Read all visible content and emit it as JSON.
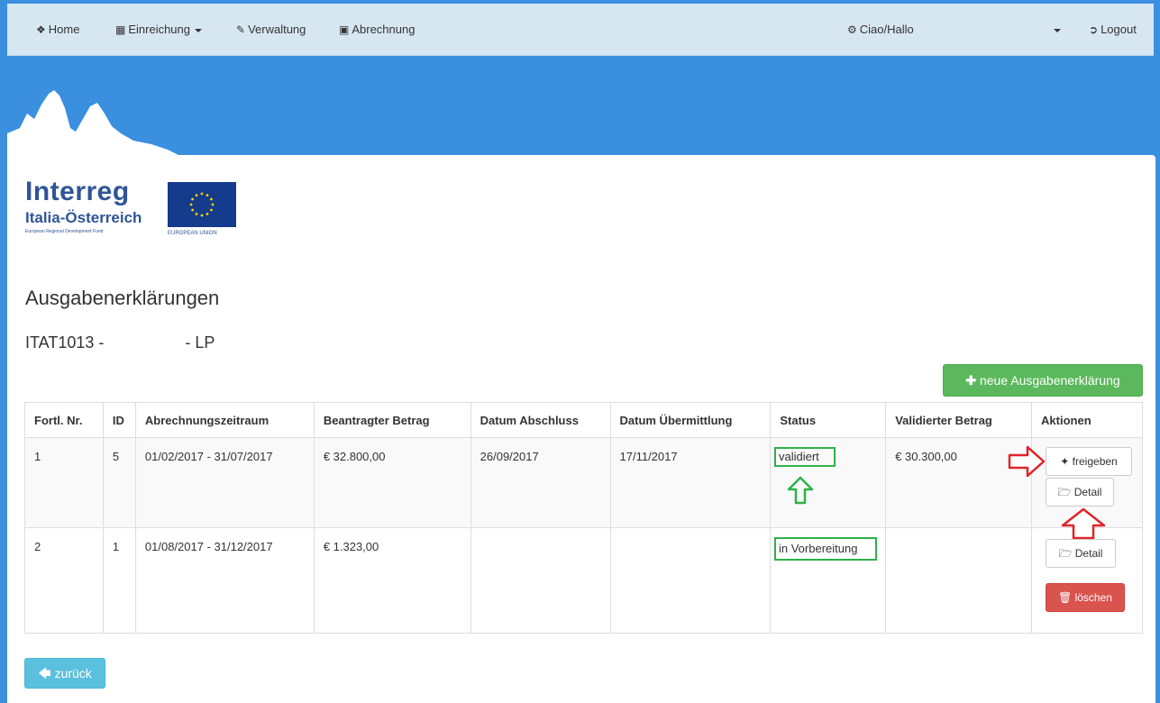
{
  "nav": {
    "home": "Home",
    "einreichung": "Einreichung",
    "verwaltung": "Verwaltung",
    "abrechnung": "Abrechnung",
    "greeting": "Ciao/Hallo",
    "logout": "Logout"
  },
  "logo": {
    "brand": "Interreg",
    "region": "Italia-Österreich",
    "fund": "European Regional Development Fund",
    "eu": "EUROPEAN UNION"
  },
  "page": {
    "title": "Ausgabenerklärungen",
    "project": "ITAT1013 -                  - LP"
  },
  "buttons": {
    "new": "neue Ausgabenerklärung",
    "back": "zurück",
    "freigeben": "freigeben",
    "detail": "Detail",
    "loeschen": "löschen"
  },
  "table": {
    "headers": [
      "Fortl. Nr.",
      "ID",
      "Abrechnungszeitraum",
      "Beantragter Betrag",
      "Datum Abschluss",
      "Datum Übermittlung",
      "Status",
      "Validierter Betrag",
      "Aktionen"
    ],
    "rows": [
      {
        "nr": "1",
        "id": "5",
        "period": "01/02/2017 - 31/07/2017",
        "amount": "€ 32.800,00",
        "closed": "26/09/2017",
        "sent": "17/11/2017",
        "status": "validiert",
        "validated": "€ 30.300,00"
      },
      {
        "nr": "2",
        "id": "1",
        "period": "01/08/2017 - 31/12/2017",
        "amount": "€ 1.323,00",
        "closed": "",
        "sent": "",
        "status": "in Vorbereitung",
        "validated": ""
      }
    ]
  },
  "colors": {
    "header_blue": "#3a8fdf",
    "navbar": "#d7e7f2",
    "success": "#5cb85c",
    "danger": "#d9534f",
    "info": "#5bc0de",
    "highlight_green": "#2fb14a",
    "annotation_red": "#e0242a"
  }
}
